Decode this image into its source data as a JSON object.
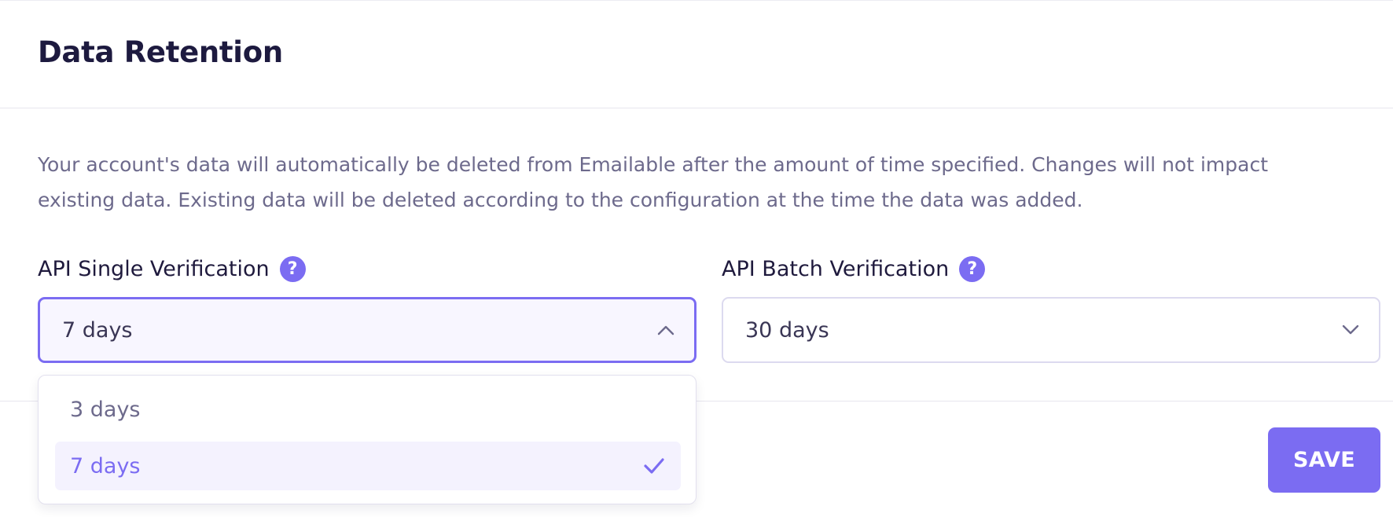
{
  "card": {
    "title": "Data Retention",
    "description": "Your account's data will automatically be deleted from Emailable after the amount of time specified. Changes will not impact existing data. Existing data will be deleted according to the configuration at the time the data was added."
  },
  "fields": {
    "single": {
      "label": "API Single Verification",
      "help_icon": "question-circle-icon",
      "selected": "7 days",
      "expanded": true,
      "options": [
        "3 days",
        "7 days"
      ]
    },
    "batch": {
      "label": "API Batch Verification",
      "help_icon": "question-circle-icon",
      "selected": "30 days",
      "expanded": false
    }
  },
  "actions": {
    "save_label": "SAVE"
  },
  "colors": {
    "accent": "#7b6cf2",
    "title": "#1d1a3f",
    "muted_text": "#6d6a8c"
  }
}
